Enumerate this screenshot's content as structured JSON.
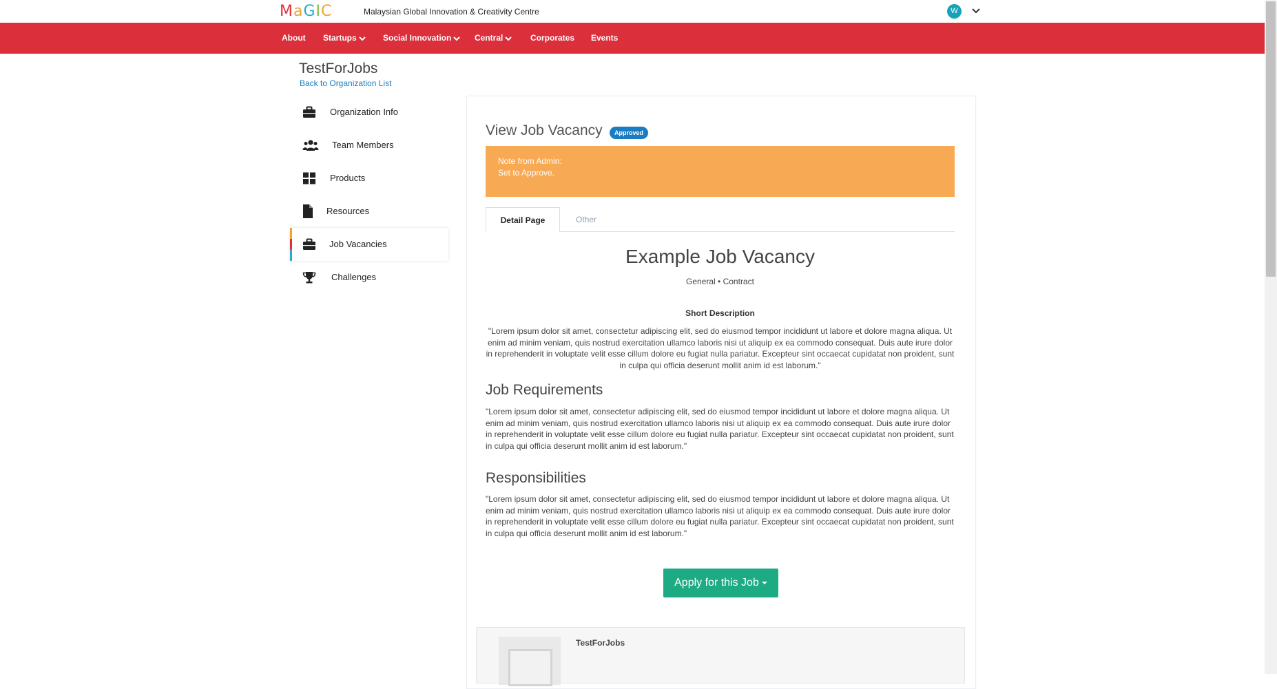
{
  "header": {
    "logo_text": "MaGIC",
    "org_full_name": "Malaysian Global Innovation & Creativity Centre",
    "avatar_initial": "W",
    "icons": {
      "user_menu": "chevron-down-icon"
    }
  },
  "nav": {
    "items": [
      {
        "label": "About",
        "has_dropdown": false
      },
      {
        "label": "Startups",
        "has_dropdown": true
      },
      {
        "label": "Social Innovation",
        "has_dropdown": true
      },
      {
        "label": "Central",
        "has_dropdown": true
      },
      {
        "label": "Corporates",
        "has_dropdown": false
      },
      {
        "label": "Events",
        "has_dropdown": false
      }
    ],
    "color": "#dc2f3c"
  },
  "sidebar": {
    "org_title": "TestForJobs",
    "back_link": "Back to Organization List",
    "items": [
      {
        "label": "Organization Info",
        "icon": "briefcase-icon"
      },
      {
        "label": "Team Members",
        "icon": "users-icon"
      },
      {
        "label": "Products",
        "icon": "grid-icon"
      },
      {
        "label": "Resources",
        "icon": "file-icon"
      },
      {
        "label": "Job Vacancies",
        "icon": "briefcase-icon",
        "active": true
      },
      {
        "label": "Challenges",
        "icon": "trophy-icon"
      }
    ]
  },
  "main": {
    "title": "View Job Vacancy",
    "status_badge": "Approved",
    "note_title": "Note from Admin:",
    "note_text": "Set to Approve.",
    "tabs": [
      {
        "label": "Detail Page",
        "active": true
      },
      {
        "label": "Other",
        "active": false
      }
    ],
    "job_title": "Example Job Vacancy",
    "job_meta": "General •  Contract",
    "short_description_heading": "Short Description",
    "short_description": "\"Lorem ipsum dolor sit amet, consectetur adipiscing elit, sed do eiusmod tempor incididunt ut labore et dolore magna aliqua. Ut enim ad minim veniam, quis nostrud exercitation ullamco laboris nisi ut aliquip ex ea commodo consequat. Duis aute irure dolor in reprehenderit in voluptate velit esse cillum dolore eu fugiat nulla pariatur. Excepteur sint occaecat cupidatat non proident, sunt in culpa qui officia deserunt mollit anim id est laborum.\"",
    "requirements_heading": "Job Requirements",
    "requirements": "\"Lorem ipsum dolor sit amet, consectetur adipiscing elit, sed do eiusmod tempor incididunt ut labore et dolore magna aliqua. Ut enim ad minim veniam, quis nostrud exercitation ullamco laboris nisi ut aliquip ex ea commodo consequat. Duis aute irure dolor in reprehenderit in voluptate velit esse cillum dolore eu fugiat nulla pariatur. Excepteur sint occaecat cupidatat non proident, sunt in culpa qui officia deserunt mollit anim id est laborum.\"",
    "responsibilities_heading": "Responsibilities",
    "responsibilities": "\"Lorem ipsum dolor sit amet, consectetur adipiscing elit, sed do eiusmod tempor incididunt ut labore et dolore magna aliqua. Ut enim ad minim veniam, quis nostrud exercitation ullamco laboris nisi ut aliquip ex ea commodo consequat. Duis aute irure dolor in reprehenderit in voluptate velit esse cillum dolore eu fugiat nulla pariatur. Excepteur sint occaecat cupidatat non proident, sunt in culpa qui officia deserunt mollit anim id est laborum.\"",
    "apply_button": "Apply for this Job",
    "org_card_name": "TestForJobs",
    "colors": {
      "note_bg": "#f7a954",
      "badge_bg": "#1a7dc4",
      "apply_bg": "#1cab83"
    }
  }
}
